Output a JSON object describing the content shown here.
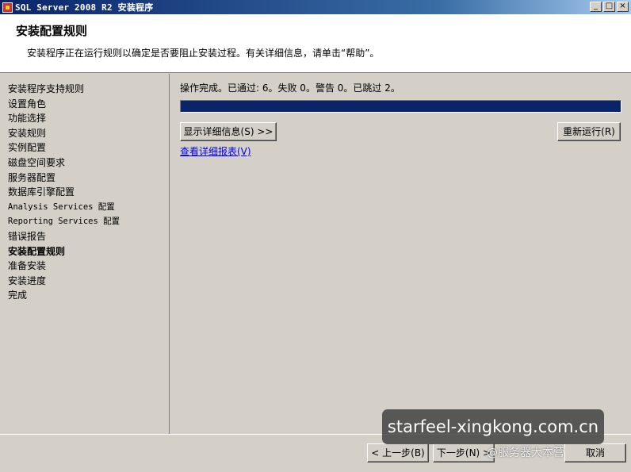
{
  "window": {
    "title": "SQL Server 2008 R2 安装程序",
    "minimize": "_",
    "maximize": "□",
    "close": "×"
  },
  "header": {
    "title": "安装配置规则",
    "description": "安装程序正在运行规则以确定是否要阻止安装过程。有关详细信息，请单击“帮助”。"
  },
  "sidebar": {
    "items": [
      {
        "label": "安装程序支持规则"
      },
      {
        "label": "设置角色"
      },
      {
        "label": "功能选择"
      },
      {
        "label": "安装规则"
      },
      {
        "label": "实例配置"
      },
      {
        "label": "磁盘空间要求"
      },
      {
        "label": "服务器配置"
      },
      {
        "label": "数据库引擎配置"
      },
      {
        "label": "Analysis Services 配置"
      },
      {
        "label": "Reporting Services 配置"
      },
      {
        "label": "错误报告"
      },
      {
        "label": "安装配置规则"
      },
      {
        "label": "准备安装"
      },
      {
        "label": "安装进度"
      },
      {
        "label": "完成"
      }
    ],
    "active_index": 11
  },
  "main": {
    "status": "操作完成。已通过: 6。失败 0。警告 0。已跳过 2。",
    "progress_percent": 100,
    "show_details_label": "显示详细信息(S) >>",
    "rerun_label": "重新运行(R)",
    "report_link": "查看详细报表(V)"
  },
  "footer": {
    "back_label": "< 上一步(B)",
    "next_label": "下一步(N) >",
    "cancel_label": "取消"
  },
  "overlay": {
    "watermark_text": "starfeel-xingkong.com.cn",
    "weibo_text": "@服务器大本营"
  }
}
